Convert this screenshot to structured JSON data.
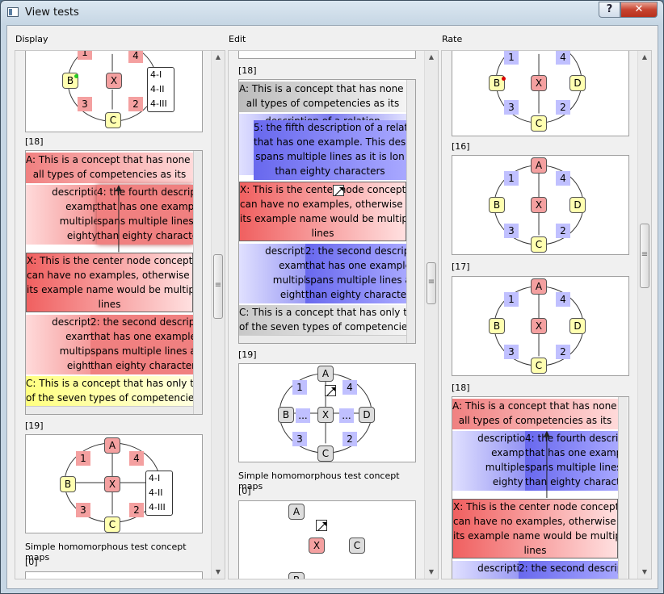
{
  "window": {
    "title": "View tests",
    "help_label": "?",
    "close_label": "✕"
  },
  "panels": [
    {
      "label": "Display"
    },
    {
      "label": "Edit"
    },
    {
      "label": "Rate"
    }
  ],
  "display": {
    "index_18": "[18]",
    "index_19": "[19]",
    "index_0": "[0]",
    "caption_maps": "Simple homomorphous test concept maps",
    "legend": [
      "4-I",
      "4-II",
      "4-III"
    ]
  },
  "edit": {
    "index_18": "[18]",
    "index_19": "[19]",
    "index_0": "[0]",
    "caption_maps": "Simple homomorphous test concept maps",
    "ellipsis": "..."
  },
  "rate": {
    "index_16": "[16]",
    "index_17": "[17]",
    "index_18": "[18]"
  },
  "nodes": {
    "A": "A",
    "B": "B",
    "C": "C",
    "D": "D",
    "X": "X",
    "n1": "1",
    "n2": "2",
    "n3": "3",
    "n4": "4"
  },
  "descriptions": {
    "a": "A: This is a concept that has none of",
    "a2": "all types of competencies as its",
    "second": "2: the second description of a relation",
    "second2": "that has one example. This desc",
    "second3": "spans multiple lines as it is",
    "second4": "than eighty characters",
    "fourth": "4: the fourth description of a rel",
    "fourth2": "that has one example. This desc",
    "fourth3": "spans multiple lines as it is lon",
    "fourth4": "than eighty characters",
    "fifth": "5: the fifth description of a relation",
    "fifth2": "that has one example. This desc",
    "fifth3": "spans multiple lines as it is lon",
    "fifth4": "than eighty characters",
    "left1": "description of a relation",
    "left2": "example. This des",
    "left3": "multiple lines as it is",
    "left4": "eighty characters",
    "x1": "X: This is the center node concept that",
    "x2": "can have no examples, otherwise each",
    "x3": "its example name would be multiple",
    "x4": "lines",
    "c1": "C: This is a concept that has only two",
    "c2": "of the seven types of competencies"
  },
  "colors": {
    "red": "#f08080",
    "blue": "#8080f0",
    "yellow": "#ffffa0",
    "gray": "#c8c8c8",
    "green_dot": "#22cc22",
    "red_dot": "#dd0000"
  }
}
